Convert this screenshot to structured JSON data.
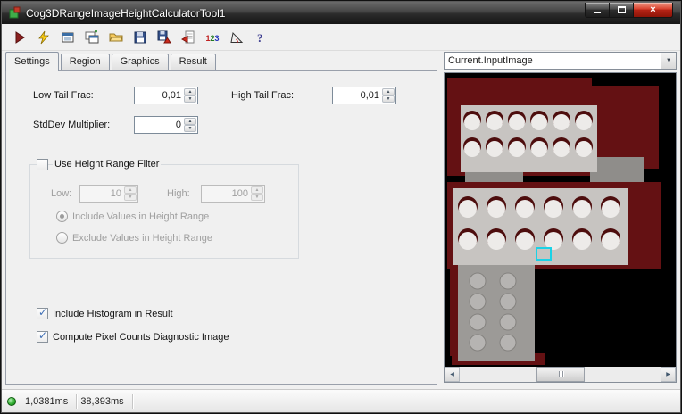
{
  "window": {
    "title": "Cog3DRangeImageHeightCalculatorTool1",
    "controls": {
      "close_glyph": "×"
    }
  },
  "toolbar": {
    "buttons": [
      "run-icon",
      "electric-run-icon",
      "show-image-window-icon",
      "new-image-window-icon",
      "open-folder-icon",
      "save-icon",
      "save-image-icon",
      "import-icon",
      "numeric-precision-icon",
      "slope-tool-icon",
      "help-icon"
    ]
  },
  "tabs": {
    "items": [
      {
        "label": "Settings",
        "active": true
      },
      {
        "label": "Region",
        "active": false
      },
      {
        "label": "Graphics",
        "active": false
      },
      {
        "label": "Result",
        "active": false
      }
    ]
  },
  "settings": {
    "low_tail_frac": {
      "label": "Low Tail Frac:",
      "value": "0,01"
    },
    "high_tail_frac": {
      "label": "High Tail Frac:",
      "value": "0,01"
    },
    "stddev_multiplier": {
      "label": "StdDev Multiplier:",
      "value": "0"
    },
    "height_range_filter": {
      "checkbox_label": "Use Height Range Filter",
      "checked": false,
      "low": {
        "label": "Low:",
        "value": "10"
      },
      "high": {
        "label": "High:",
        "value": "100"
      },
      "include_radio": {
        "label": "Include Values in Height Range",
        "selected": true
      },
      "exclude_radio": {
        "label": "Exclude Values in Height Range",
        "selected": false
      }
    },
    "include_histogram": {
      "label": "Include Histogram in Result",
      "checked": true
    },
    "compute_pixel_counts": {
      "label": "Compute Pixel Counts Diagnostic Image",
      "checked": true
    }
  },
  "image_panel": {
    "selector_value": "Current.InputImage",
    "colors": {
      "background": "#000000",
      "range_red": "#641113",
      "plate_light": "#c7c4c1",
      "plate_mid": "#9c9a97",
      "circle_white": "#edebe9",
      "selection_cyan": "#19d2e6"
    }
  },
  "status": {
    "led_color": "#2fae2f",
    "time_1": "1,0381ms",
    "time_2": "38,393ms"
  }
}
